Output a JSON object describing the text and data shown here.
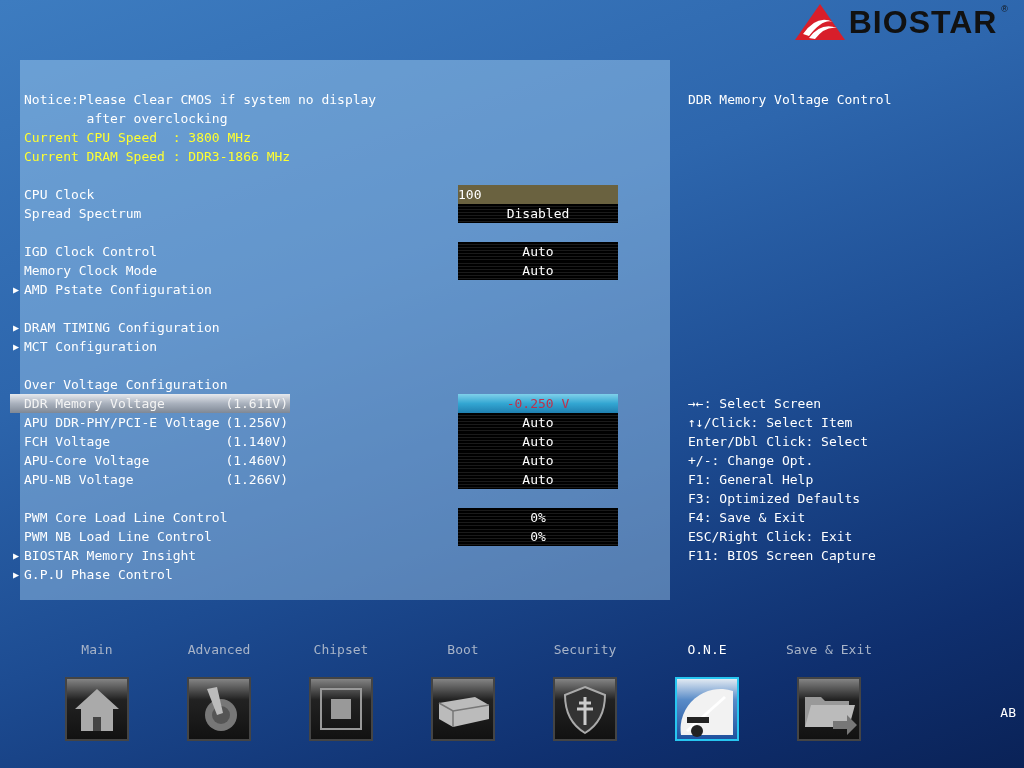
{
  "brand": {
    "name": "BIOSTAR",
    "mark": "®"
  },
  "settings_groups": [
    [
      {
        "kind": "notice",
        "label": "Notice:Please Clear CMOS if system no display"
      },
      {
        "kind": "notice",
        "label": "        after overclocking"
      },
      {
        "kind": "info",
        "label": "Current CPU Speed  : 3800 MHz"
      },
      {
        "kind": "info",
        "label": "Current DRAM Speed : DDR3-1866 MHz"
      }
    ],
    [
      {
        "kind": "field",
        "label": "CPU Clock",
        "value": "100",
        "selected": false
      },
      {
        "kind": "option",
        "label": "Spread Spectrum",
        "value": "Disabled",
        "selected": false
      }
    ],
    [
      {
        "kind": "option",
        "label": "IGD Clock Control",
        "value": "Auto",
        "selected": false
      },
      {
        "kind": "option",
        "label": "Memory Clock Mode",
        "value": "Auto",
        "selected": false
      },
      {
        "kind": "submenu",
        "arrow": "▶",
        "label": "AMD Pstate Configuration"
      }
    ],
    [
      {
        "kind": "submenu",
        "arrow": "▶",
        "label": "DRAM TIMING Configuration"
      },
      {
        "kind": "submenu",
        "arrow": "▶",
        "label": "MCT Configuration"
      }
    ],
    [
      {
        "kind": "heading",
        "label": "Over Voltage Configuration"
      },
      {
        "kind": "option",
        "label": "DDR Memory Voltage",
        "reading": "(1.611V)",
        "value": "-0.250 V",
        "selected": true
      },
      {
        "kind": "option",
        "label": "APU DDR-PHY/PCI-E Voltage",
        "reading": "(1.256V)",
        "value": "Auto",
        "selected": false
      },
      {
        "kind": "option",
        "label": "FCH Voltage",
        "reading": "(1.140V)",
        "value": "Auto",
        "selected": false
      },
      {
        "kind": "option",
        "label": "APU-Core Voltage",
        "reading": "(1.460V)",
        "value": "Auto",
        "selected": false
      },
      {
        "kind": "option",
        "label": "APU-NB Voltage",
        "reading": "(1.266V)",
        "value": "Auto",
        "selected": false
      }
    ],
    [
      {
        "kind": "option",
        "label": "PWM Core Load Line Control",
        "value": "0%",
        "selected": false
      },
      {
        "kind": "option",
        "label": "PWM NB Load Line Control",
        "value": "0%",
        "selected": false
      },
      {
        "kind": "submenu",
        "arrow": "▶",
        "label": "BIOSTAR Memory Insight"
      },
      {
        "kind": "submenu",
        "arrow": "▶",
        "label": "G.P.U Phase Control"
      }
    ]
  ],
  "help_text": "DDR Memory Voltage Control",
  "key_help": [
    "→←: Select Screen",
    "↑↓/Click: Select Item",
    "Enter/Dbl Click: Select",
    "+/-: Change Opt.",
    "F1: General Help",
    "F3: Optimized Defaults",
    "F4: Save & Exit",
    "ESC/Right Click: Exit",
    "F11: BIOS Screen Capture"
  ],
  "tabs": [
    {
      "label": "Main",
      "selected": false
    },
    {
      "label": "Advanced",
      "selected": false
    },
    {
      "label": "Chipset",
      "selected": false
    },
    {
      "label": "Boot",
      "selected": false
    },
    {
      "label": "Security",
      "selected": false
    },
    {
      "label": "O.N.E",
      "selected": true
    },
    {
      "label": "Save & Exit",
      "selected": false
    }
  ],
  "corner_label": "AB"
}
